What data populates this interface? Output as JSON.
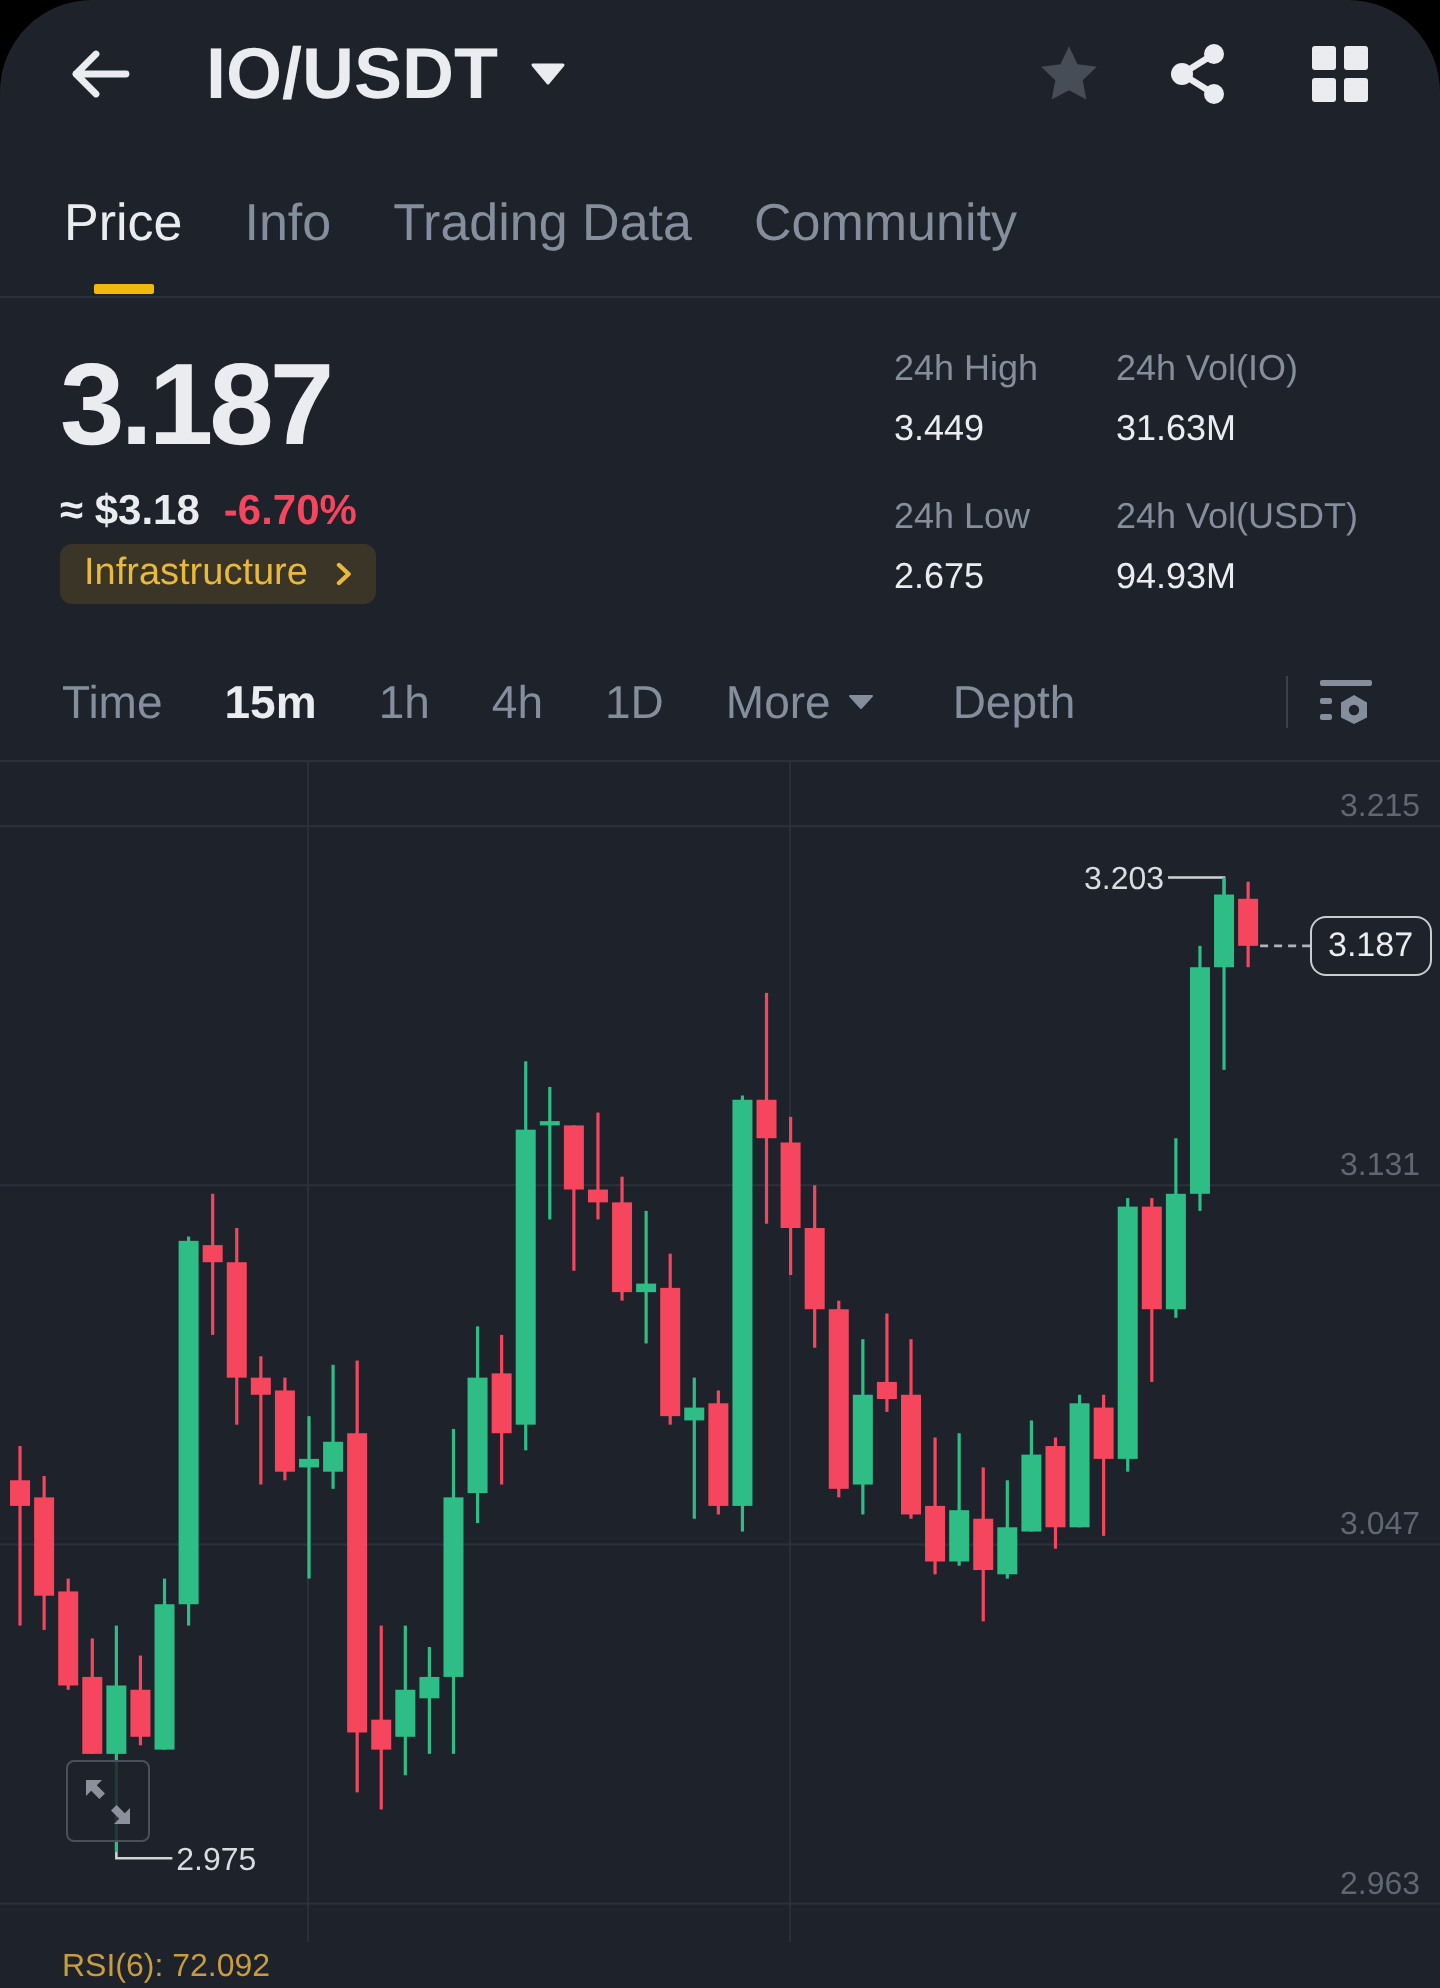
{
  "header": {
    "title": "IO/USDT",
    "favorite": false
  },
  "tabs": [
    {
      "label": "Price",
      "selected": true
    },
    {
      "label": "Info",
      "selected": false
    },
    {
      "label": "Trading Data",
      "selected": false
    },
    {
      "label": "Community",
      "selected": false
    }
  ],
  "ticker": {
    "last_price": "3.187",
    "fiat_price": "≈ $3.18",
    "change": "-6.70%",
    "category": "Infrastructure"
  },
  "stats": [
    {
      "label": "24h High",
      "value": "3.449"
    },
    {
      "label": "24h Vol(IO)",
      "value": "31.63M"
    },
    {
      "label": "24h Low",
      "value": "2.675"
    },
    {
      "label": "24h Vol(USDT)",
      "value": "94.93M"
    }
  ],
  "intervals": [
    {
      "label": "Time",
      "kind": "option",
      "selected": false
    },
    {
      "label": "15m",
      "kind": "option",
      "selected": true
    },
    {
      "label": "1h",
      "kind": "option",
      "selected": false
    },
    {
      "label": "4h",
      "kind": "option",
      "selected": false
    },
    {
      "label": "1D",
      "kind": "option",
      "selected": false
    },
    {
      "label": "More",
      "kind": "menu",
      "selected": false
    },
    {
      "label": "Depth",
      "kind": "option",
      "selected": false
    }
  ],
  "chart": {
    "chart_data": {
      "type": "candlestick",
      "categories": [
        null,
        null,
        null,
        null,
        null,
        null,
        null,
        null,
        null,
        null,
        null,
        null,
        null,
        null,
        null,
        null,
        null,
        null,
        null,
        null,
        null,
        null,
        null,
        null,
        null,
        null,
        null,
        null,
        null,
        null,
        null,
        null,
        null,
        null,
        null,
        null,
        null,
        null,
        null,
        null,
        null,
        null,
        null,
        null,
        null,
        null,
        null,
        null,
        null,
        null,
        null,
        null,
        null,
        null,
        null,
        null,
        null,
        null,
        null
      ],
      "ohlc": [
        [
          3.062,
          3.07,
          3.028,
          3.056
        ],
        [
          3.058,
          3.063,
          3.027,
          3.035
        ],
        [
          3.036,
          3.039,
          3.013,
          3.014
        ],
        [
          3.016,
          3.025,
          2.998,
          2.998
        ],
        [
          2.998,
          3.028,
          2.975,
          3.014
        ],
        [
          3.013,
          3.021,
          3.0,
          3.002
        ],
        [
          2.999,
          3.039,
          2.999,
          3.033
        ],
        [
          3.033,
          3.119,
          3.028,
          3.118
        ],
        [
          3.117,
          3.129,
          3.096,
          3.113
        ],
        [
          3.113,
          3.121,
          3.075,
          3.086
        ],
        [
          3.086,
          3.091,
          3.061,
          3.082
        ],
        [
          3.083,
          3.086,
          3.062,
          3.064
        ],
        [
          3.065,
          3.077,
          3.039,
          3.067
        ],
        [
          3.064,
          3.089,
          3.06,
          3.071
        ],
        [
          3.073,
          3.09,
          2.989,
          3.003
        ],
        [
          3.006,
          3.028,
          2.985,
          2.999
        ],
        [
          3.002,
          3.028,
          2.993,
          3.013
        ],
        [
          3.011,
          3.023,
          2.998,
          3.016
        ],
        [
          3.016,
          3.074,
          2.998,
          3.058
        ],
        [
          3.059,
          3.098,
          3.052,
          3.086
        ],
        [
          3.087,
          3.096,
          3.061,
          3.073
        ],
        [
          3.075,
          3.16,
          3.069,
          3.144
        ],
        [
          3.145,
          3.154,
          3.123,
          3.146
        ],
        [
          3.145,
          3.145,
          3.111,
          3.13
        ],
        [
          3.13,
          3.148,
          3.123,
          3.127
        ],
        [
          3.127,
          3.133,
          3.104,
          3.106
        ],
        [
          3.106,
          3.125,
          3.094,
          3.108
        ],
        [
          3.107,
          3.115,
          3.075,
          3.077
        ],
        [
          3.076,
          3.086,
          3.053,
          3.079
        ],
        [
          3.08,
          3.083,
          3.054,
          3.056
        ],
        [
          3.056,
          3.152,
          3.05,
          3.151
        ],
        [
          3.151,
          3.176,
          3.122,
          3.142
        ],
        [
          3.141,
          3.147,
          3.11,
          3.121
        ],
        [
          3.121,
          3.131,
          3.093,
          3.102
        ],
        [
          3.102,
          3.104,
          3.058,
          3.06
        ],
        [
          3.061,
          3.095,
          3.054,
          3.082
        ],
        [
          3.085,
          3.101,
          3.078,
          3.081
        ],
        [
          3.082,
          3.095,
          3.053,
          3.054
        ],
        [
          3.056,
          3.072,
          3.04,
          3.043
        ],
        [
          3.043,
          3.073,
          3.042,
          3.055
        ],
        [
          3.053,
          3.065,
          3.029,
          3.041
        ],
        [
          3.04,
          3.062,
          3.039,
          3.051
        ],
        [
          3.05,
          3.076,
          3.05,
          3.068
        ],
        [
          3.07,
          3.072,
          3.046,
          3.051
        ],
        [
          3.051,
          3.082,
          3.051,
          3.08
        ],
        [
          3.079,
          3.082,
          3.049,
          3.067
        ],
        [
          3.067,
          3.128,
          3.064,
          3.126
        ],
        [
          3.126,
          3.128,
          3.085,
          3.102
        ],
        [
          3.102,
          3.142,
          3.1,
          3.129
        ],
        [
          3.129,
          3.187,
          3.125,
          3.182
        ],
        [
          3.182,
          3.203,
          3.158,
          3.199
        ],
        [
          3.198,
          3.202,
          3.182,
          3.187
        ],
        null,
        null,
        null,
        null,
        null,
        null,
        null
      ],
      "ylim": [
        2.954,
        3.23
      ],
      "yticks": [
        {
          "value": 3.215,
          "label": "3.215"
        },
        {
          "value": 3.131,
          "label": "3.131"
        },
        {
          "value": 3.047,
          "label": "3.047"
        },
        {
          "value": 2.963,
          "label": "2.963"
        }
      ],
      "grid": true
    },
    "high_label": "3.203",
    "low_label": "2.975",
    "last_price_tag": "3.187",
    "indicator": "RSI(6): 72.092"
  }
}
